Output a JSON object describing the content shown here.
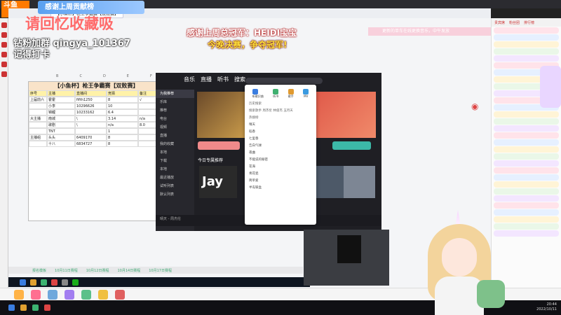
{
  "header": {
    "overlay_title": "感谢上周贡献榜",
    "overlay_red": "请回忆收藏吸",
    "overlay_white": "钻粉加群 qingya_101367 记得打卡",
    "logo": "斗鱼"
  },
  "headline": {
    "line1": "感谢上周总冠军：HEIDI宝宝",
    "line2": "今晚决赛，争夺冠军!"
  },
  "ticker": "更新的单车在线更换音乐，中午发放",
  "sheet": {
    "title": "【小鱼杯】枪王争霸赛【双败赛】",
    "col_letters": [
      "B",
      "C",
      "D",
      "E",
      "F"
    ],
    "header_row": [
      "序号",
      "主播",
      "直播间",
      "竞猜",
      "备注"
    ],
    "rows": [
      [
        "上届前六",
        "霍霍",
        "fifth1250",
        "8",
        "√"
      ],
      [
        "",
        "小李",
        "10296626",
        "10",
        ""
      ],
      [
        "",
        "锦鲤",
        "10233162",
        "6.4",
        ""
      ],
      [
        "大主播",
        "南城",
        "\\",
        "3.14",
        "n/a"
      ],
      [
        "",
        "歌剧",
        "\\",
        "n/a",
        "8.0"
      ],
      [
        "",
        "TNT",
        "",
        "1",
        ""
      ],
      [
        "主播组",
        "头头",
        "6409170",
        "8",
        ""
      ],
      [
        "",
        "十八",
        "6834727",
        "8",
        ""
      ]
    ],
    "tabs": [
      "报名模板",
      "10月11日赛程",
      "10月12日赛程",
      "10月14日赛程",
      "10月17日赛程"
    ]
  },
  "music": {
    "tabs": [
      "音乐",
      "直播",
      "听书",
      "搜索"
    ],
    "side_items": [
      "为我推荐",
      "乐库",
      "推荐",
      "电台",
      "视频",
      "直播",
      "我的收藏",
      "本地",
      "下载",
      "本地",
      "最近播放",
      "试听列表",
      "默认列表"
    ],
    "section": "今日专属推荐",
    "thumb_text": "Jay",
    "now_playing": "晴天 - 周杰伦"
  },
  "popup": {
    "icons": [
      "听歌识曲",
      "听书",
      "歌手",
      "MV"
    ],
    "history_label": "历史搜索",
    "tags": [
      "搜索歌手",
      "周杰伦",
      "林俊杰",
      "五月天"
    ],
    "hot_label": "热搜榜",
    "hot_list": [
      "晴天",
      "稻香",
      "七里香",
      "告白气球",
      "夜曲",
      "不能说的秘密",
      "花海",
      "青花瓷",
      "简单爱",
      "半岛铁盒"
    ]
  },
  "chat": {
    "tabs": [
      "贵宾席",
      "粉丝团",
      "排行榜"
    ]
  },
  "clock": {
    "time": "20:44",
    "date": "2022/10/11"
  },
  "colors": {
    "accent": "#ff7a00",
    "sheet_header": "#f9e3c9",
    "highlight_row": "#fff2a8"
  }
}
